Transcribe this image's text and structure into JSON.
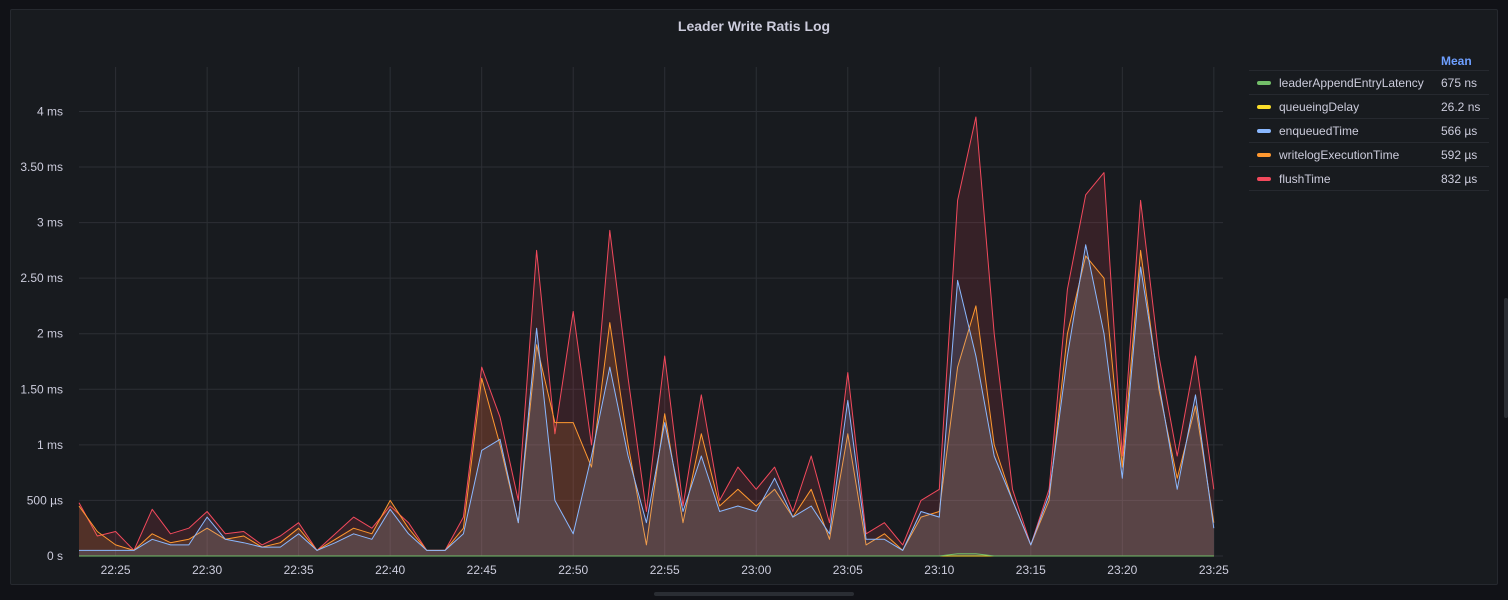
{
  "panel": {
    "title": "Leader Write Ratis Log"
  },
  "legend": {
    "header": "Mean",
    "items": [
      {
        "name": "leaderAppendEntryLatency",
        "value": "675 ns",
        "color": "#73bf69"
      },
      {
        "name": "queueingDelay",
        "value": "26.2 ns",
        "color": "#fade2a"
      },
      {
        "name": "enqueuedTime",
        "value": "566 µs",
        "color": "#8ab8ff"
      },
      {
        "name": "writelogExecutionTime",
        "value": "592 µs",
        "color": "#ff9830"
      },
      {
        "name": "flushTime",
        "value": "832 µs",
        "color": "#f2495c"
      }
    ]
  },
  "chart_data": {
    "type": "area",
    "x_unit": "time",
    "y_unit": "ms",
    "ylim": [
      0,
      4.4
    ],
    "grid": true,
    "legend_placement": "right",
    "y_ticks": [
      {
        "value": 0,
        "label": "0 s"
      },
      {
        "value": 0.5,
        "label": "500 µs"
      },
      {
        "value": 1,
        "label": "1 ms"
      },
      {
        "value": 1.5,
        "label": "1.50 ms"
      },
      {
        "value": 2,
        "label": "2 ms"
      },
      {
        "value": 2.5,
        "label": "2.50 ms"
      },
      {
        "value": 3,
        "label": "3 ms"
      },
      {
        "value": 3.5,
        "label": "3.50 ms"
      },
      {
        "value": 4,
        "label": "4 ms"
      }
    ],
    "x_ticks": [
      "22:25",
      "22:30",
      "22:35",
      "22:40",
      "22:45",
      "22:50",
      "22:55",
      "23:00",
      "23:05",
      "23:10",
      "23:15",
      "23:20",
      "23:25"
    ],
    "x_start": "22:23",
    "x_end": "23:25.5",
    "series": [
      {
        "name": "flushTime",
        "color": "#f2495c",
        "points": [
          [
            "22:23",
            0.48
          ],
          [
            "22:24",
            0.18
          ],
          [
            "22:25",
            0.22
          ],
          [
            "22:26",
            0.05
          ],
          [
            "22:27",
            0.42
          ],
          [
            "22:28",
            0.2
          ],
          [
            "22:29",
            0.25
          ],
          [
            "22:30",
            0.4
          ],
          [
            "22:31",
            0.2
          ],
          [
            "22:32",
            0.22
          ],
          [
            "22:33",
            0.1
          ],
          [
            "22:34",
            0.18
          ],
          [
            "22:35",
            0.3
          ],
          [
            "22:36",
            0.05
          ],
          [
            "22:37",
            0.2
          ],
          [
            "22:38",
            0.35
          ],
          [
            "22:39",
            0.25
          ],
          [
            "22:40",
            0.45
          ],
          [
            "22:41",
            0.3
          ],
          [
            "22:42",
            0.05
          ],
          [
            "22:43",
            0.05
          ],
          [
            "22:44",
            0.35
          ],
          [
            "22:45",
            1.7
          ],
          [
            "22:46",
            1.25
          ],
          [
            "22:47",
            0.5
          ],
          [
            "22:48",
            2.75
          ],
          [
            "22:49",
            1.1
          ],
          [
            "22:50",
            2.2
          ],
          [
            "22:51",
            1.0
          ],
          [
            "22:52",
            2.93
          ],
          [
            "22:53",
            1.6
          ],
          [
            "22:54",
            0.4
          ],
          [
            "22:55",
            1.8
          ],
          [
            "22:56",
            0.45
          ],
          [
            "22:57",
            1.45
          ],
          [
            "22:58",
            0.5
          ],
          [
            "22:59",
            0.8
          ],
          [
            "23:00",
            0.6
          ],
          [
            "23:01",
            0.8
          ],
          [
            "23:02",
            0.4
          ],
          [
            "23:03",
            0.9
          ],
          [
            "23:04",
            0.3
          ],
          [
            "23:05",
            1.65
          ],
          [
            "23:06",
            0.2
          ],
          [
            "23:07",
            0.3
          ],
          [
            "23:08",
            0.1
          ],
          [
            "23:09",
            0.5
          ],
          [
            "23:10",
            0.6
          ],
          [
            "23:11",
            3.2
          ],
          [
            "23:12",
            3.95
          ],
          [
            "23:13",
            2.0
          ],
          [
            "23:14",
            0.6
          ],
          [
            "23:15",
            0.1
          ],
          [
            "23:16",
            0.6
          ],
          [
            "23:17",
            2.4
          ],
          [
            "23:18",
            3.25
          ],
          [
            "23:19",
            3.45
          ],
          [
            "23:20",
            0.9
          ],
          [
            "23:21",
            3.2
          ],
          [
            "23:22",
            1.8
          ],
          [
            "23:23",
            0.9
          ],
          [
            "23:24",
            1.8
          ],
          [
            "23:25",
            0.6
          ]
        ]
      },
      {
        "name": "writelogExecutionTime",
        "color": "#ff9830",
        "points": [
          [
            "22:23",
            0.45
          ],
          [
            "22:24",
            0.22
          ],
          [
            "22:25",
            0.1
          ],
          [
            "22:26",
            0.05
          ],
          [
            "22:27",
            0.2
          ],
          [
            "22:28",
            0.12
          ],
          [
            "22:29",
            0.15
          ],
          [
            "22:30",
            0.25
          ],
          [
            "22:31",
            0.15
          ],
          [
            "22:32",
            0.18
          ],
          [
            "22:33",
            0.08
          ],
          [
            "22:34",
            0.12
          ],
          [
            "22:35",
            0.25
          ],
          [
            "22:36",
            0.05
          ],
          [
            "22:37",
            0.15
          ],
          [
            "22:38",
            0.25
          ],
          [
            "22:39",
            0.2
          ],
          [
            "22:40",
            0.5
          ],
          [
            "22:41",
            0.25
          ],
          [
            "22:42",
            0.05
          ],
          [
            "22:43",
            0.05
          ],
          [
            "22:44",
            0.25
          ],
          [
            "22:45",
            1.6
          ],
          [
            "22:46",
            1.0
          ],
          [
            "22:47",
            0.3
          ],
          [
            "22:48",
            1.9
          ],
          [
            "22:49",
            1.2
          ],
          [
            "22:50",
            1.2
          ],
          [
            "22:51",
            0.8
          ],
          [
            "22:52",
            2.1
          ],
          [
            "22:53",
            1.0
          ],
          [
            "22:54",
            0.1
          ],
          [
            "22:55",
            1.28
          ],
          [
            "22:56",
            0.3
          ],
          [
            "22:57",
            1.1
          ],
          [
            "22:58",
            0.45
          ],
          [
            "22:59",
            0.6
          ],
          [
            "23:00",
            0.45
          ],
          [
            "23:01",
            0.6
          ],
          [
            "23:02",
            0.35
          ],
          [
            "23:03",
            0.6
          ],
          [
            "23:04",
            0.15
          ],
          [
            "23:05",
            1.1
          ],
          [
            "23:06",
            0.1
          ],
          [
            "23:07",
            0.2
          ],
          [
            "23:08",
            0.05
          ],
          [
            "23:09",
            0.35
          ],
          [
            "23:10",
            0.4
          ],
          [
            "23:11",
            1.7
          ],
          [
            "23:12",
            2.25
          ],
          [
            "23:13",
            1.0
          ],
          [
            "23:14",
            0.5
          ],
          [
            "23:15",
            0.1
          ],
          [
            "23:16",
            0.5
          ],
          [
            "23:17",
            2.0
          ],
          [
            "23:18",
            2.7
          ],
          [
            "23:19",
            2.5
          ],
          [
            "23:20",
            0.8
          ],
          [
            "23:21",
            2.75
          ],
          [
            "23:22",
            1.5
          ],
          [
            "23:23",
            0.7
          ],
          [
            "23:24",
            1.35
          ],
          [
            "23:25",
            0.3
          ]
        ]
      },
      {
        "name": "enqueuedTime",
        "color": "#8ab8ff",
        "points": [
          [
            "22:23",
            0.05
          ],
          [
            "22:24",
            0.05
          ],
          [
            "22:25",
            0.05
          ],
          [
            "22:26",
            0.05
          ],
          [
            "22:27",
            0.15
          ],
          [
            "22:28",
            0.1
          ],
          [
            "22:29",
            0.1
          ],
          [
            "22:30",
            0.35
          ],
          [
            "22:31",
            0.15
          ],
          [
            "22:32",
            0.12
          ],
          [
            "22:33",
            0.08
          ],
          [
            "22:34",
            0.08
          ],
          [
            "22:35",
            0.2
          ],
          [
            "22:36",
            0.05
          ],
          [
            "22:37",
            0.12
          ],
          [
            "22:38",
            0.2
          ],
          [
            "22:39",
            0.15
          ],
          [
            "22:40",
            0.42
          ],
          [
            "22:41",
            0.2
          ],
          [
            "22:42",
            0.05
          ],
          [
            "22:43",
            0.05
          ],
          [
            "22:44",
            0.2
          ],
          [
            "22:45",
            0.95
          ],
          [
            "22:46",
            1.05
          ],
          [
            "22:47",
            0.3
          ],
          [
            "22:48",
            2.05
          ],
          [
            "22:49",
            0.5
          ],
          [
            "22:50",
            0.2
          ],
          [
            "22:51",
            0.9
          ],
          [
            "22:52",
            1.7
          ],
          [
            "22:53",
            0.9
          ],
          [
            "22:54",
            0.3
          ],
          [
            "22:55",
            1.2
          ],
          [
            "22:56",
            0.4
          ],
          [
            "22:57",
            0.9
          ],
          [
            "22:58",
            0.4
          ],
          [
            "22:59",
            0.45
          ],
          [
            "23:00",
            0.4
          ],
          [
            "23:01",
            0.7
          ],
          [
            "23:02",
            0.35
          ],
          [
            "23:03",
            0.45
          ],
          [
            "23:04",
            0.2
          ],
          [
            "23:05",
            1.4
          ],
          [
            "23:06",
            0.15
          ],
          [
            "23:07",
            0.15
          ],
          [
            "23:08",
            0.05
          ],
          [
            "23:09",
            0.4
          ],
          [
            "23:10",
            0.35
          ],
          [
            "23:11",
            2.48
          ],
          [
            "23:12",
            1.8
          ],
          [
            "23:13",
            0.9
          ],
          [
            "23:14",
            0.5
          ],
          [
            "23:15",
            0.1
          ],
          [
            "23:16",
            0.55
          ],
          [
            "23:17",
            1.8
          ],
          [
            "23:18",
            2.8
          ],
          [
            "23:19",
            2.0
          ],
          [
            "23:20",
            0.7
          ],
          [
            "23:21",
            2.6
          ],
          [
            "23:22",
            1.55
          ],
          [
            "23:23",
            0.6
          ],
          [
            "23:24",
            1.45
          ],
          [
            "23:25",
            0.25
          ]
        ]
      },
      {
        "name": "queueingDelay",
        "color": "#fade2a",
        "points": [
          [
            "22:23",
            0.0
          ],
          [
            "23:25",
            0.0
          ]
        ]
      },
      {
        "name": "leaderAppendEntryLatency",
        "color": "#73bf69",
        "points": [
          [
            "22:23",
            0.0
          ],
          [
            "23:10",
            0.0
          ],
          [
            "23:11",
            0.02
          ],
          [
            "23:12",
            0.02
          ],
          [
            "23:13",
            0.0
          ],
          [
            "23:25",
            0.0
          ]
        ]
      }
    ]
  }
}
